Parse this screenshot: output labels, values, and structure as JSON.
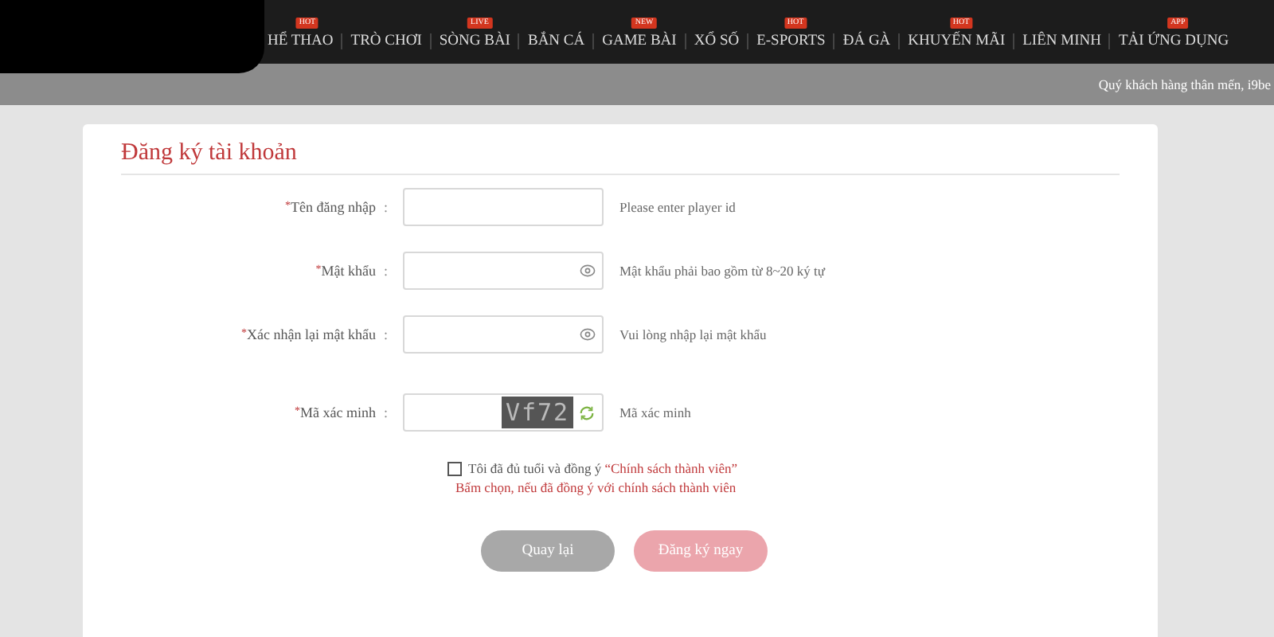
{
  "nav": [
    {
      "label": "HỂ THAO",
      "badge": "HOT"
    },
    {
      "label": "TRÒ CHƠI"
    },
    {
      "label": "SÒNG BÀI",
      "badge": "LIVE"
    },
    {
      "label": "BẮN CÁ"
    },
    {
      "label": "GAME BÀI",
      "badge": "NEW"
    },
    {
      "label": "XỔ SỐ"
    },
    {
      "label": "E-SPORTS",
      "badge": "HOT"
    },
    {
      "label": "ĐÁ GÀ"
    },
    {
      "label": "KHUYẾN MÃI",
      "badge": "HOT"
    },
    {
      "label": "LIÊN MINH"
    },
    {
      "label": "TẢI ỨNG DỤNG",
      "badge": "APP"
    }
  ],
  "marquee": "Quý khách hàng thân mến, i9be",
  "form": {
    "title": "Đăng ký tài khoản",
    "fields": [
      {
        "kind": "text",
        "mark": "*",
        "label": "Tên đăng nhập",
        "colon": ":",
        "hint": "Please enter player id"
      },
      {
        "kind": "password",
        "mark": "*",
        "label": "Mật khẩu",
        "colon": ":",
        "hint": "Mật khẩu phải bao gồm từ 8~20 ký tự"
      },
      {
        "kind": "password",
        "mark": "*",
        "label": "Xác nhận lại mật khẩu",
        "colon": ":",
        "hint": "Vui lòng nhập lại mật khẩu"
      },
      {
        "kind": "captcha",
        "mark": "*",
        "label": "Mã xác minh",
        "colon": ":",
        "captcha": "Vf72",
        "hint": "Mã xác minh"
      }
    ],
    "agree": {
      "checked": false,
      "text": "Tôi đã đủ tuổi và đồng ý",
      "link": "“Chính sách thành viên”",
      "error": "Bấm chọn, nếu đã đồng ý với chính sách thành viên"
    },
    "buttons": [
      {
        "kind": "back",
        "label": "Quay lại"
      },
      {
        "kind": "submit",
        "label": "Đăng ký ngay"
      }
    ]
  }
}
